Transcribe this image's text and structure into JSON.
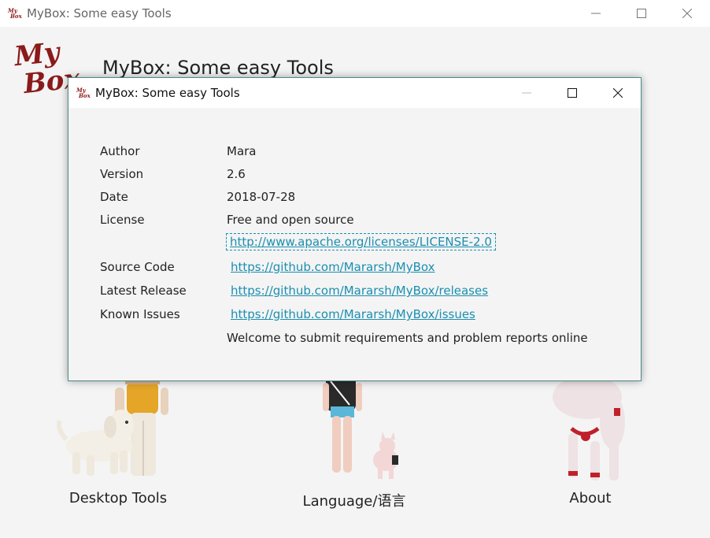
{
  "main_window": {
    "title": "MyBox: Some easy Tools",
    "heading": "MyBox: Some easy Tools",
    "logo_line1": "My",
    "logo_line2": "Box",
    "icon_line1": "My",
    "icon_line2": "Box"
  },
  "features": [
    {
      "label": "Desktop Tools"
    },
    {
      "label": "Language/语言"
    },
    {
      "label": "About"
    }
  ],
  "dialog": {
    "title": "MyBox: Some easy Tools",
    "icon_line1": "My",
    "icon_line2": "Box",
    "rows": {
      "author_label": "Author",
      "author_value": "Mara",
      "version_label": "Version",
      "version_value": "2.6",
      "date_label": "Date",
      "date_value": "2018-07-28",
      "license_label": "License",
      "license_value": "Free and open source",
      "license_link": "http://www.apache.org/licenses/LICENSE-2.0",
      "source_label": "Source Code",
      "source_link": "https://github.com/Mararsh/MyBox",
      "release_label": "Latest Release",
      "release_link": "https://github.com/Mararsh/MyBox/releases",
      "issues_label": "Known Issues",
      "issues_link": "https://github.com/Mararsh/MyBox/issues",
      "welcome": "Welcome to submit requirements and problem reports online"
    }
  },
  "colors": {
    "accent_link": "#1a8fb0",
    "logo": "#8b1a1a",
    "dialog_border": "#4c8a8a"
  },
  "icons": {
    "minimize": "minimize-icon",
    "maximize": "maximize-icon",
    "close": "close-icon"
  }
}
